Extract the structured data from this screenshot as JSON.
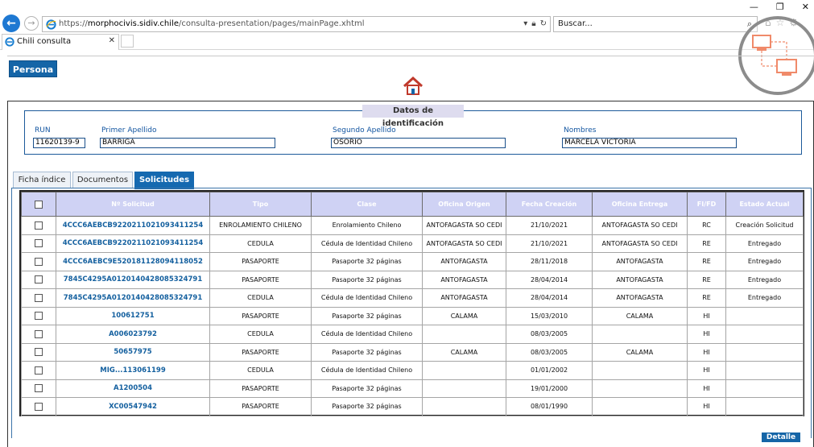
{
  "browser": {
    "url_prefix": "https://",
    "url_host": "morphocivis.sidiv.chile",
    "url_path": "/consulta-presentation/pages/mainPage.xhtml",
    "search_placeholder": "Buscar...",
    "tab_title": "Chili consulta",
    "window_controls": [
      "—",
      "❐",
      "✕"
    ]
  },
  "page": {
    "persona_tab": "Persona",
    "fieldset_legend": "Datos de identificación",
    "fields": [
      {
        "label": "RUN",
        "value": "11620139-9"
      },
      {
        "label": "Primer Apellido",
        "value": "BARRIGA"
      },
      {
        "label": "Segundo Apellido",
        "value": "OSORIO"
      },
      {
        "label": "Nombres",
        "value": "MARCELA VICTORIA"
      }
    ],
    "tabs": [
      "Ficha índice",
      "Documentos",
      "Solicitudes"
    ],
    "active_tab": "Solicitudes",
    "detalle_button": "Detalle"
  },
  "table": {
    "headers": [
      "",
      "Nº Solicitud",
      "Tipo",
      "Clase",
      "Oficina Origen",
      "Fecha Creación",
      "Oficina Entrega",
      "FI/FD",
      "Estado Actual"
    ],
    "rows": [
      [
        "4CCC6AEBCB9220211021093411254",
        "ENROLAMIENTO CHILENO",
        "Enrolamiento Chileno",
        "ANTOFAGASTA SO CEDI",
        "21/10/2021",
        "ANTOFAGASTA SO CEDI",
        "RC",
        "Creación Solicitud"
      ],
      [
        "4CCC6AEBCB9220211021093411254",
        "CEDULA",
        "Cédula de Identidad Chileno",
        "ANTOFAGASTA SO CEDI",
        "21/10/2021",
        "ANTOFAGASTA SO CEDI",
        "RE",
        "Entregado"
      ],
      [
        "4CCC6AEBC9E520181128094118052",
        "PASAPORTE",
        "Pasaporte 32 páginas",
        "ANTOFAGASTA",
        "28/11/2018",
        "ANTOFAGASTA",
        "RE",
        "Entregado"
      ],
      [
        "7845C4295A0120140428085324791",
        "PASAPORTE",
        "Pasaporte 32 páginas",
        "ANTOFAGASTA",
        "28/04/2014",
        "ANTOFAGASTA",
        "RE",
        "Entregado"
      ],
      [
        "7845C4295A0120140428085324791",
        "CEDULA",
        "Cédula de Identidad Chileno",
        "ANTOFAGASTA",
        "28/04/2014",
        "ANTOFAGASTA",
        "RE",
        "Entregado"
      ],
      [
        "100612751",
        "PASAPORTE",
        "Pasaporte 32 páginas",
        "CALAMA",
        "15/03/2010",
        "CALAMA",
        "HI",
        ""
      ],
      [
        "A006023792",
        "CEDULA",
        "Cédula de Identidad Chileno",
        "",
        "08/03/2005",
        "",
        "HI",
        ""
      ],
      [
        "50657975",
        "PASAPORTE",
        "Pasaporte 32 páginas",
        "CALAMA",
        "08/03/2005",
        "CALAMA",
        "HI",
        ""
      ],
      [
        "MIG...113061199",
        "CEDULA",
        "Cédula de Identidad Chileno",
        "",
        "01/01/2002",
        "",
        "HI",
        ""
      ],
      [
        "A1200504",
        "PASAPORTE",
        "Pasaporte 32 páginas",
        "",
        "19/01/2000",
        "",
        "HI",
        ""
      ],
      [
        "XC00547942",
        "PASAPORTE",
        "Pasaporte 32 páginas",
        "",
        "08/01/1990",
        "",
        "HI",
        ""
      ]
    ]
  },
  "colors": {
    "accent": "#1565a7",
    "header_bg": "#cfd2f4",
    "link": "#14609f"
  }
}
